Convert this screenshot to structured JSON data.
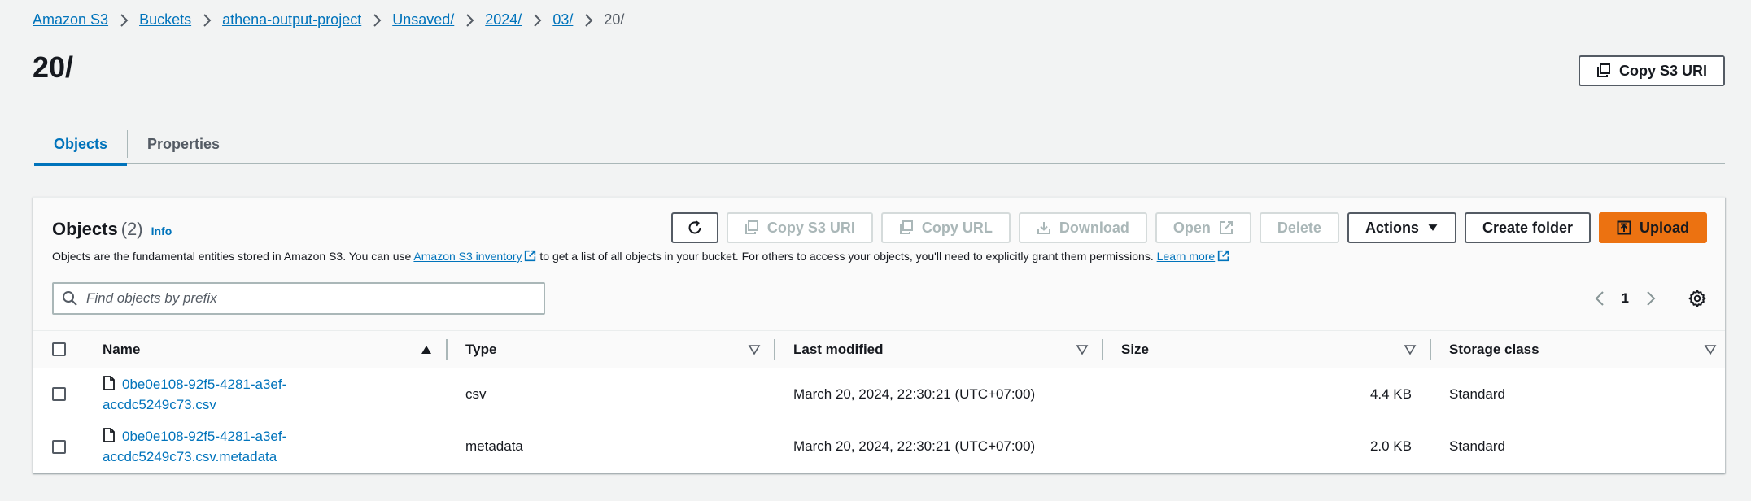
{
  "breadcrumb": [
    "Amazon S3",
    "Buckets",
    "athena-output-project",
    "Unsaved/",
    "2024/",
    "03/",
    "20/"
  ],
  "title": "20/",
  "copy_uri_top": "Copy S3 URI",
  "tabs": [
    {
      "label": "Objects",
      "active": true
    },
    {
      "label": "Properties",
      "active": false
    }
  ],
  "objects": {
    "heading": "Objects",
    "count": "(2)",
    "info": "Info",
    "desc_part1": "Objects are the fundamental entities stored in Amazon S3. You can use ",
    "desc_link1": "Amazon S3 inventory",
    "desc_part2": " to get a list of all objects in your bucket. For others to access your objects, you'll need to explicitly grant them permissions. ",
    "desc_link2": "Learn more"
  },
  "toolbar": {
    "copy_s3_uri": "Copy S3 URI",
    "copy_url": "Copy URL",
    "download": "Download",
    "open": "Open",
    "delete": "Delete",
    "actions": "Actions",
    "create_folder": "Create folder",
    "upload": "Upload"
  },
  "search": {
    "placeholder": "Find objects by prefix",
    "value": ""
  },
  "pagination": {
    "current_page": "1"
  },
  "columns": [
    "Name",
    "Type",
    "Last modified",
    "Size",
    "Storage class"
  ],
  "rows": [
    {
      "name_line1": "0be0e108-92f5-4281-a3ef-",
      "name_line2": "accdc5249c73.csv",
      "type": "csv",
      "modified": "March 20, 2024, 22:30:21 (UTC+07:00)",
      "size": "4.4 KB",
      "class": "Standard"
    },
    {
      "name_line1": "0be0e108-92f5-4281-a3ef-",
      "name_line2": "accdc5249c73.csv.metadata",
      "type": "metadata",
      "modified": "March 20, 2024, 22:30:21 (UTC+07:00)",
      "size": "2.0 KB",
      "class": "Standard"
    }
  ],
  "colors": {
    "link": "#0073bb",
    "primary": "#ec7211",
    "background": "#f2f3f3"
  }
}
